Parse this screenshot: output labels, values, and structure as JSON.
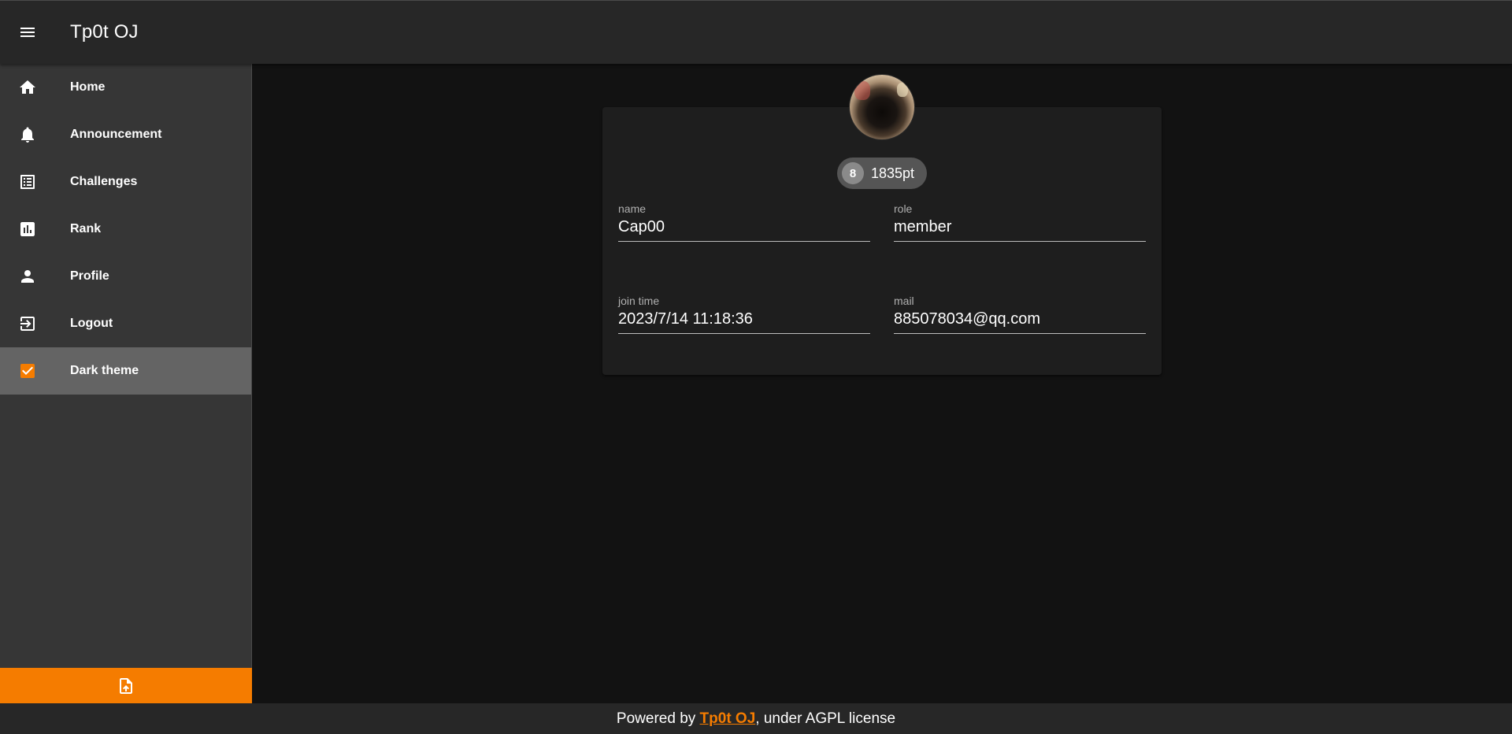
{
  "app": {
    "title": "Tp0t OJ"
  },
  "colors": {
    "accent": "#f57c00",
    "appbar": "#272727",
    "drawer": "#363636",
    "background": "#121212",
    "card": "#1e1e1e"
  },
  "sidebar": {
    "items": [
      {
        "label": "Home",
        "icon": "home-icon"
      },
      {
        "label": "Announcement",
        "icon": "bell-icon"
      },
      {
        "label": "Challenges",
        "icon": "list-icon"
      },
      {
        "label": "Rank",
        "icon": "chart-icon"
      },
      {
        "label": "Profile",
        "icon": "person-icon"
      },
      {
        "label": "Logout",
        "icon": "logout-icon"
      },
      {
        "label": "Dark theme",
        "icon": "checkbox-checked-icon",
        "checked": true
      }
    ],
    "upload_icon": "file-upload-icon"
  },
  "profile": {
    "rank": "8",
    "score": "1835pt",
    "fields": {
      "name": {
        "label": "name",
        "value": "Cap00"
      },
      "role": {
        "label": "role",
        "value": "member"
      },
      "join_time": {
        "label": "join time",
        "value": "2023/7/14 11:18:36"
      },
      "mail": {
        "label": "mail",
        "value": "885078034@qq.com"
      }
    }
  },
  "footer": {
    "prefix": "Powered by ",
    "link": "Tp0t OJ",
    "suffix": ", under AGPL license"
  }
}
